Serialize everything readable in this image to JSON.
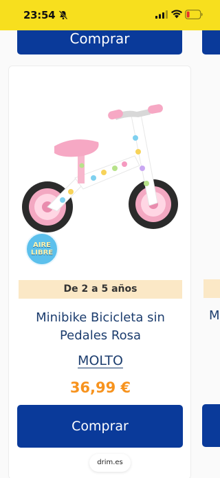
{
  "status_bar": {
    "time": "23:54",
    "background_color": "#f7df1e",
    "icons": [
      "bell-slash-icon",
      "signal-icon",
      "wifi-icon",
      "battery-low-icon"
    ]
  },
  "top_button": {
    "label": "Comprar"
  },
  "product": {
    "badge": {
      "line1": "AIRE",
      "line2": "LIBRE"
    },
    "age_range": "De 2 a 5 años",
    "title": "Minibike Bicicleta sin Pedales Rosa",
    "brand": "MOLTO",
    "price": "36,99 €",
    "buy_label": "Comprar"
  },
  "next_product": {
    "title_partial": "M"
  },
  "browser": {
    "url": "drim.es"
  },
  "colors": {
    "primary_blue": "#0a3a9a",
    "price_orange": "#f7931e",
    "age_band": "#fbe8c6",
    "title_navy": "#1c3d6e"
  }
}
